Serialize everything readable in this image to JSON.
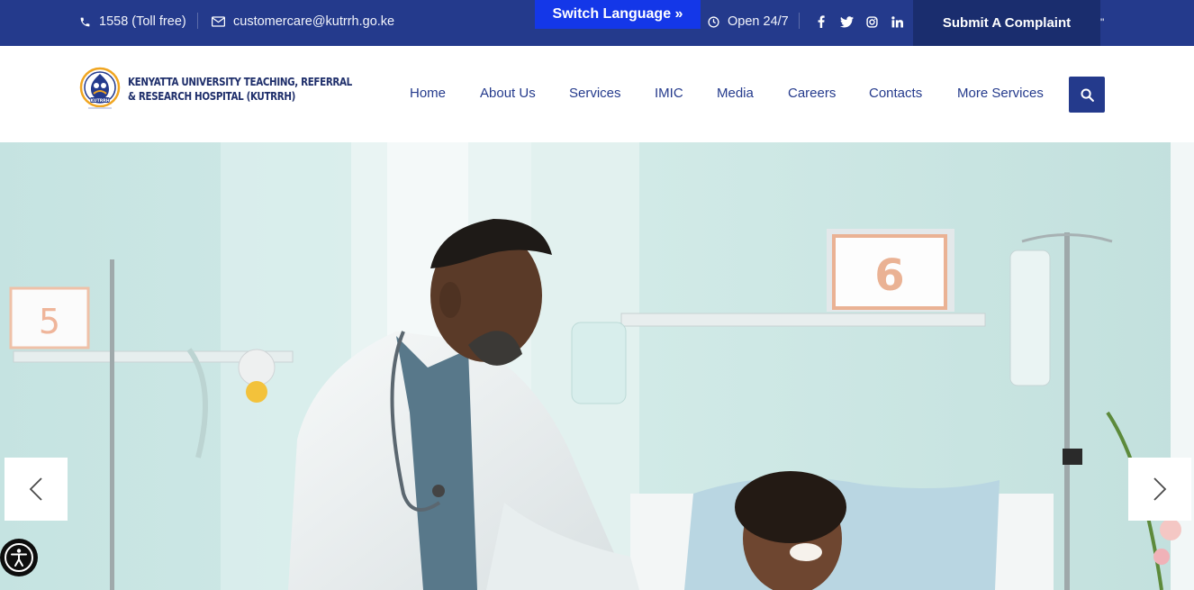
{
  "topbar": {
    "phone": "1558 (Toll free)",
    "email": "customercare@kutrrh.go.ke",
    "switch_language": "Switch Language »",
    "hours": "Open 24/7",
    "social": [
      "f",
      "t",
      "ig",
      "in"
    ],
    "complaint": "Submit A Complaint",
    "tick": "\""
  },
  "header": {
    "logo_line1": "KENYATTA UNIVERSITY TEACHING, REFERRAL",
    "logo_line2": "& RESEARCH HOSPITAL (KUTRRH)",
    "logo_badge": "KUTRRH",
    "nav": [
      "Home",
      "About Us",
      "Services",
      "IMIC",
      "Media",
      "Careers",
      "Contacts",
      "More Services"
    ]
  },
  "hero": {
    "bed_sign_left": "5",
    "bed_sign_right": "6"
  },
  "icons": {
    "phone": "phone-icon",
    "email": "envelope-icon",
    "clock": "clock-icon",
    "search": "search-icon",
    "prev": "chevron-left-icon",
    "next": "chevron-right-icon",
    "accessibility": "accessibility-icon"
  },
  "colors": {
    "primary": "#243a8c",
    "switch_lang": "#1437e8",
    "complaint_bg": "#1a2d6e"
  }
}
